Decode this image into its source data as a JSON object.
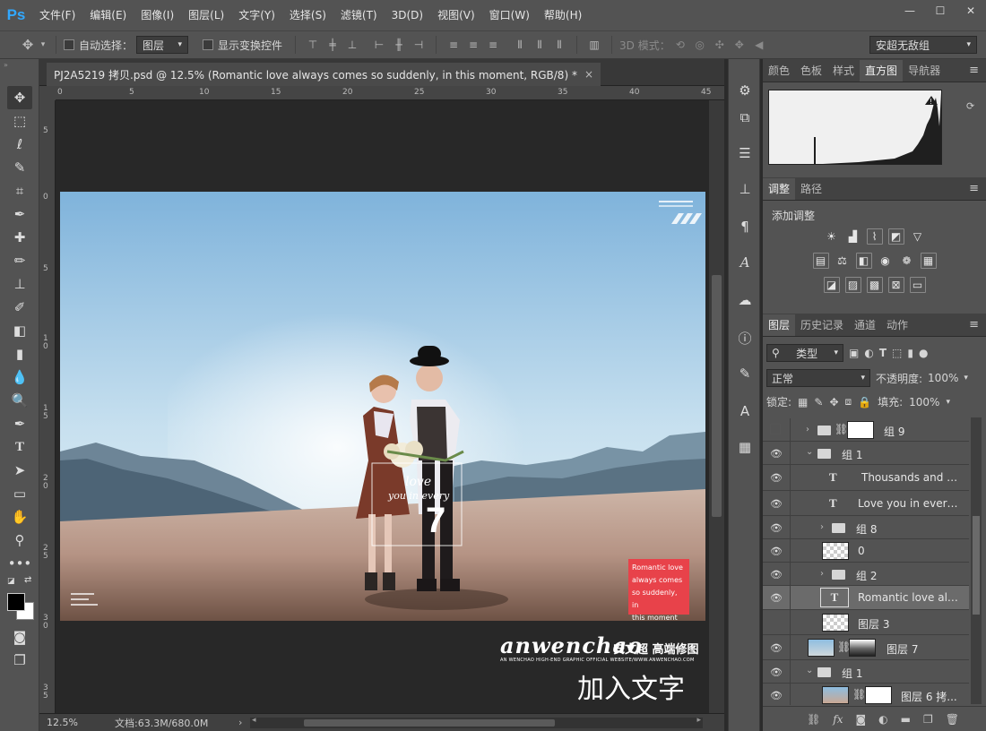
{
  "app": {
    "logo": "Ps"
  },
  "menu": [
    "文件(F)",
    "编辑(E)",
    "图像(I)",
    "图层(L)",
    "文字(Y)",
    "选择(S)",
    "滤镜(T)",
    "3D(D)",
    "视图(V)",
    "窗口(W)",
    "帮助(H)"
  ],
  "options": {
    "auto_select_label": "自动选择：",
    "auto_select_value": "图层",
    "show_transform_label": "显示变换控件",
    "mode_3d_label": "3D 模式：",
    "workspace": "安超无敌组"
  },
  "document": {
    "tab_title": "PJ2A5219 拷贝.psd @ 12.5% (Romantic love  always comes  so suddenly, in  this moment, RGB/8) *",
    "tab_close": "×",
    "zoom": "12.5%",
    "doc_size": "文档:63.3M/680.0M"
  },
  "rulers": {
    "h": [
      "0",
      "5",
      "10",
      "15",
      "20",
      "25",
      "30",
      "35",
      "40",
      "45"
    ],
    "v": [
      "5",
      "0",
      "5",
      "1 0",
      "1 5",
      "2 0",
      "2 5",
      "3 0",
      "3 5"
    ]
  },
  "photo_text": {
    "love1": "love",
    "love2": "you in every",
    "number": "7",
    "brand_script": "anwenchao",
    "brand_cn": "安文超 高端修图",
    "brand_sub": "AN WENCHAO HIGH-END GRAPHIC OFFICIAL WEBSITE/WWW.ANWENCHAO.COM",
    "red_box": [
      "Romantic love",
      "always comes",
      "so suddenly, in",
      "this moment"
    ],
    "add_text": "加入文字"
  },
  "panels": {
    "top_tabs": [
      "颜色",
      "色板",
      "样式",
      "直方图",
      "导航器"
    ],
    "top_active": 3,
    "mid_tabs": [
      "调整",
      "路径"
    ],
    "mid_active": 0,
    "adjust_title": "添加调整",
    "layer_tabs": [
      "图层",
      "历史记录",
      "通道",
      "动作"
    ],
    "layer_active": 0,
    "filter_label": "类型",
    "blend_mode": "正常",
    "opacity_label": "不透明度:",
    "opacity_value": "100%",
    "lock_label": "锁定:",
    "fill_label": "填充:",
    "fill_value": "100%"
  },
  "layers": [
    {
      "name": "组 9"
    },
    {
      "name": "组 1"
    },
    {
      "name": "Thousands and th..."
    },
    {
      "name": "Love you in every s..."
    },
    {
      "name": "组 8"
    },
    {
      "name": "0"
    },
    {
      "name": "组 2"
    },
    {
      "name": "Romantic love  alw..."
    },
    {
      "name": "图层 3"
    },
    {
      "name": "图层 7"
    },
    {
      "name": "组 1"
    },
    {
      "name": "图层 6 拷..."
    }
  ],
  "colors": {
    "accent": "#31a8ff",
    "red_box": "#e8424a"
  }
}
